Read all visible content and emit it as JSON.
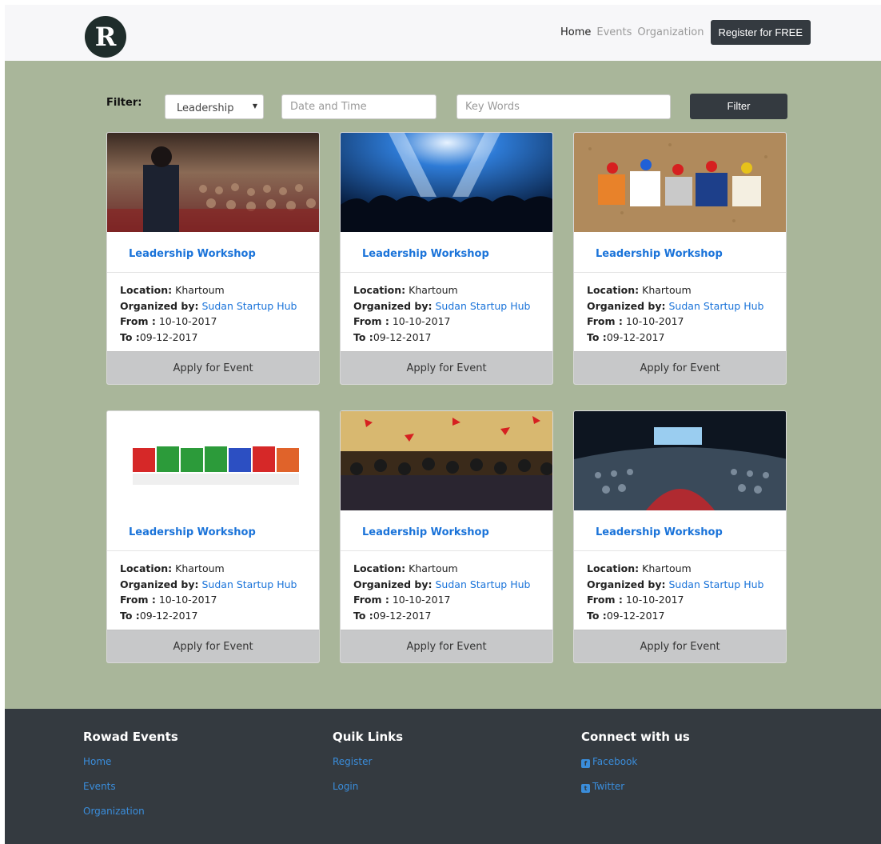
{
  "brand": {
    "logo_letter": "R"
  },
  "nav": {
    "home": "Home",
    "events": "Events",
    "organization": "Organization",
    "register": "Register for FREE"
  },
  "filter": {
    "label": "Filter:",
    "category_selected": "Leadership",
    "date_placeholder": "Date and Time",
    "keywords_placeholder": "Key Words",
    "button": "Filter"
  },
  "labels": {
    "location": "Location:",
    "organized_by": "Organized by:",
    "from": "From :",
    "to": "To :",
    "apply": "Apply for Event"
  },
  "events": [
    {
      "title": "Leadership Workshop",
      "location": "Khartoum",
      "organizer": "Sudan Startup Hub",
      "from": "10-10-2017",
      "to": "09-12-2017",
      "image": "conference-speaker-photo"
    },
    {
      "title": "Leadership Workshop",
      "location": "Khartoum",
      "organizer": "Sudan Startup Hub",
      "from": "10-10-2017",
      "to": "09-12-2017",
      "image": "concert-crowd-photo"
    },
    {
      "title": "Leadership Workshop",
      "location": "Khartoum",
      "organizer": "Sudan Startup Hub",
      "from": "10-10-2017",
      "to": "09-12-2017",
      "image": "event-corkboard-photo"
    },
    {
      "title": "Leadership Workshop",
      "location": "Khartoum",
      "organizer": "Sudan Startup Hub",
      "from": "10-10-2017",
      "to": "09-12-2017",
      "image": "events-blocks-photo"
    },
    {
      "title": "Leadership Workshop",
      "location": "Khartoum",
      "organizer": "Sudan Startup Hub",
      "from": "10-10-2017",
      "to": "09-12-2017",
      "image": "party-group-photo"
    },
    {
      "title": "Leadership Workshop",
      "location": "Khartoum",
      "organizer": "Sudan Startup Hub",
      "from": "10-10-2017",
      "to": "09-12-2017",
      "image": "auditorium-photo"
    }
  ],
  "footer": {
    "about_title": "Rowad Events",
    "about_links": [
      "Home",
      "Events",
      "Organization"
    ],
    "quick_title": "Quik Links",
    "quick_links": [
      "Register",
      "Login"
    ],
    "connect_title": "Connect with us",
    "social": [
      {
        "label": "Facebook",
        "icon": "facebook-icon"
      },
      {
        "label": "Twitter",
        "icon": "twitter-icon"
      }
    ]
  },
  "colors": {
    "main_bg": "#a9b69a",
    "dark": "#343a40",
    "link": "#1a73d9"
  }
}
